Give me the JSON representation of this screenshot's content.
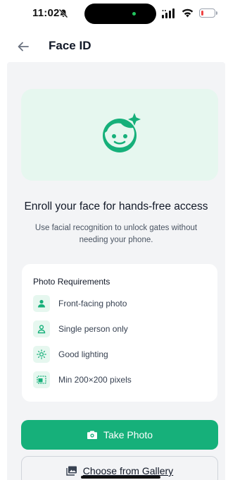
{
  "status_bar": {
    "time": "11:02",
    "battery_level": 0.2
  },
  "header": {
    "title": "Face ID",
    "back_icon": "arrow-left-icon"
  },
  "hero": {
    "icon": "face-sparkle-icon",
    "headline": "Enroll your face for hands-free access",
    "subtext": "Use facial recognition to unlock gates without needing your phone."
  },
  "requirements": {
    "title": "Photo Requirements",
    "items": [
      {
        "icon": "person-icon",
        "label": "Front-facing photo"
      },
      {
        "icon": "single-person-icon",
        "label": "Single person only"
      },
      {
        "icon": "sun-icon",
        "label": "Good lighting"
      },
      {
        "icon": "image-size-icon",
        "label": "Min 200×200 pixels"
      }
    ]
  },
  "actions": {
    "take_photo_label": "Take Photo",
    "gallery_label": "Choose from Gallery"
  },
  "colors": {
    "accent": "#16b07a",
    "accent_light": "#e6f7ef",
    "panel": "#f3f4f6"
  }
}
